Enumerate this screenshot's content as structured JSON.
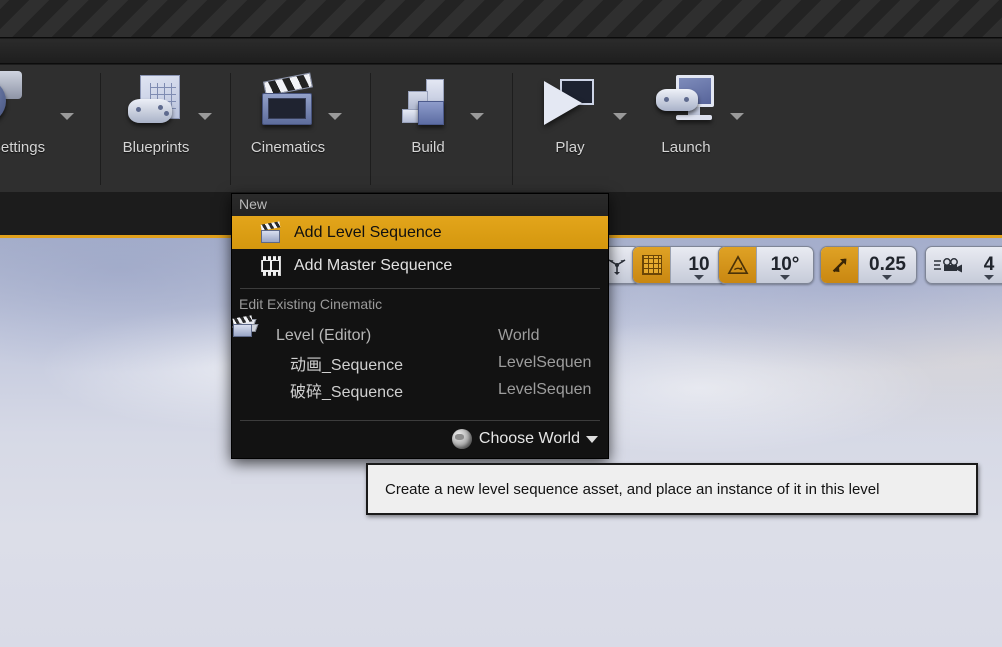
{
  "window": {
    "titlebar_name": "title-bar-striped",
    "accent_orange": "#e0a01c",
    "menu_bg": "#121212",
    "highlight": "#e3a51b"
  },
  "toolbar": {
    "items": [
      {
        "label": "Settings",
        "icon": "gears-icon",
        "has_arrow": true
      },
      {
        "label": "Blueprints",
        "icon": "blueprint-gamepad-icon",
        "has_arrow": true
      },
      {
        "label": "Cinematics",
        "icon": "clapperboard-icon",
        "has_arrow": true
      },
      {
        "label": "Build",
        "icon": "build-blocks-icon",
        "has_arrow": true
      },
      {
        "label": "Play",
        "icon": "play-screen-icon",
        "has_arrow": true
      },
      {
        "label": "Launch",
        "icon": "launch-monitor-gamepad-icon",
        "has_arrow": true
      }
    ]
  },
  "viewport_toolbar": {
    "surface_snap": {
      "icon": "surface-snap-icon",
      "active": false
    },
    "grid_snap": {
      "icon": "grid-snap-icon",
      "active": true,
      "value": "10"
    },
    "angle_snap": {
      "icon": "angle-snap-icon",
      "active": true,
      "value": "10°"
    },
    "scale_snap": {
      "icon": "scale-snap-icon",
      "active": true,
      "value": "0.25"
    },
    "camera_speed": {
      "icon": "camera-speed-icon",
      "active": false,
      "value": "4"
    }
  },
  "menu": {
    "header": "New",
    "new_items": [
      {
        "label": "Add Level Sequence",
        "icon": "clapperboard-icon",
        "selected": true
      },
      {
        "label": "Add Master Sequence",
        "icon": "film-strip-icon",
        "selected": false
      }
    ],
    "section_label": "Edit Existing Cinematic",
    "tree": [
      {
        "label": "Level (Editor)",
        "type": "World",
        "icon": "level-editor-icon",
        "indent": 0,
        "expanded": true
      },
      {
        "label": "动画_Sequence",
        "type": "LevelSequen",
        "icon": "clapperboard-icon",
        "indent": 1
      },
      {
        "label": "破碎_Sequence",
        "type": "LevelSequen",
        "icon": "clapperboard-icon",
        "indent": 1
      }
    ],
    "footer": {
      "label": "Choose World",
      "icon": "globe-icon"
    }
  },
  "tooltip": {
    "text": "Create a new level sequence asset, and place an instance of it in this level"
  }
}
